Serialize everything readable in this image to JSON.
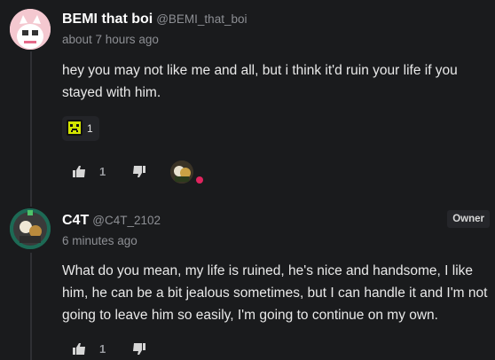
{
  "comments": [
    {
      "author": "BEMI that boi",
      "handle": "@BEMI_that_boi",
      "time": "about 7 hours ago",
      "text": "hey you may not like me and all, but i think it'd ruin your life if you stayed with him.",
      "reaction": {
        "icon": "pixel-face-emoji",
        "count": "1"
      },
      "upvotes": "1"
    },
    {
      "author": "C4T",
      "handle": "@C4T_2102",
      "time": "6 minutes ago",
      "badge": "Owner",
      "text": "What do you mean, my life is ruined, he's nice and handsome, I like him, he can be a bit jealous sometimes, but I can handle it and I'm not going to leave him so easily, I'm going to continue on my own.",
      "upvotes": "1"
    }
  ],
  "colors": {
    "background": "#1a1b1d",
    "muted": "#8d8f94",
    "status_dot": "#e0245e",
    "reaction_yellow": "#d4e500"
  }
}
